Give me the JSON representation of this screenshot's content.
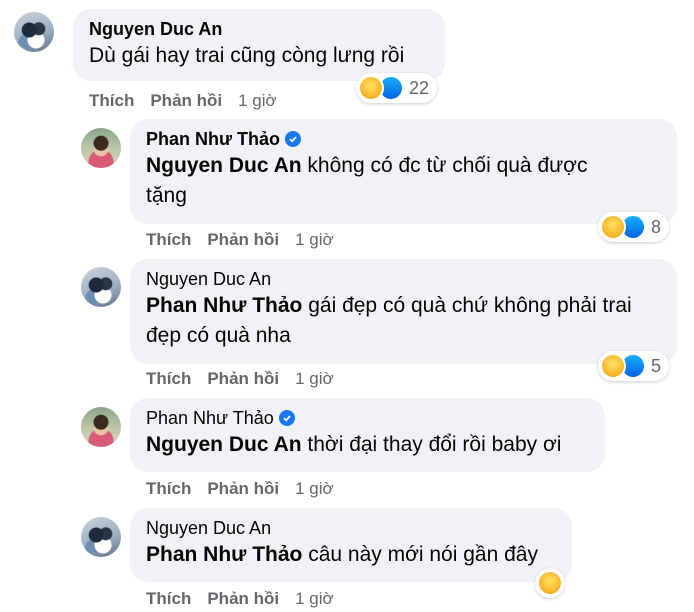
{
  "comments": [
    {
      "author": "Nguyen Duc An",
      "verified": false,
      "text": "Dù gái hay trai cũng còng lưng rồi",
      "reaction_count": "22",
      "actions": {
        "like": "Thích",
        "reply": "Phản hồi",
        "time": "1 giờ"
      }
    },
    {
      "author": "Phan Như Thảo",
      "verified": true,
      "mention": "Nguyen Duc An",
      "text": "không có đc từ chối quà được",
      "text_line2": "tặng",
      "reaction_count": "8",
      "actions": {
        "like": "Thích",
        "reply": "Phản hồi",
        "time": "1 giờ"
      }
    },
    {
      "author": "Nguyen Duc An",
      "verified": false,
      "mention": "Phan Như Thảo",
      "text": "gái đẹp có quà chứ không phải trai",
      "text_line2": "đẹp có quà nha",
      "reaction_count": "5",
      "actions": {
        "like": "Thích",
        "reply": "Phản hồi",
        "time": "1 giờ"
      }
    },
    {
      "author": "Phan Như Thảo",
      "verified": true,
      "mention": "Nguyen Duc An",
      "text": "thời đại thay đổi rồi baby ơi",
      "actions": {
        "like": "Thích",
        "reply": "Phản hồi",
        "time": "1 giờ"
      }
    },
    {
      "author": "Nguyen Duc An",
      "verified": false,
      "mention": "Phan Như Thảo",
      "text": "câu này mới nói gần đây",
      "actions": {
        "like": "Thích",
        "reply": "Phản hồi",
        "time": "1 giờ"
      }
    }
  ],
  "colors": {
    "bubble": "#f0f2f5",
    "secondary_text": "#65676b",
    "verified": "#1877f2"
  },
  "icons": {
    "reaction_haha": "haha-emoji-icon",
    "reaction_like": "like-thumb-icon",
    "verified": "verified-badge-icon"
  }
}
